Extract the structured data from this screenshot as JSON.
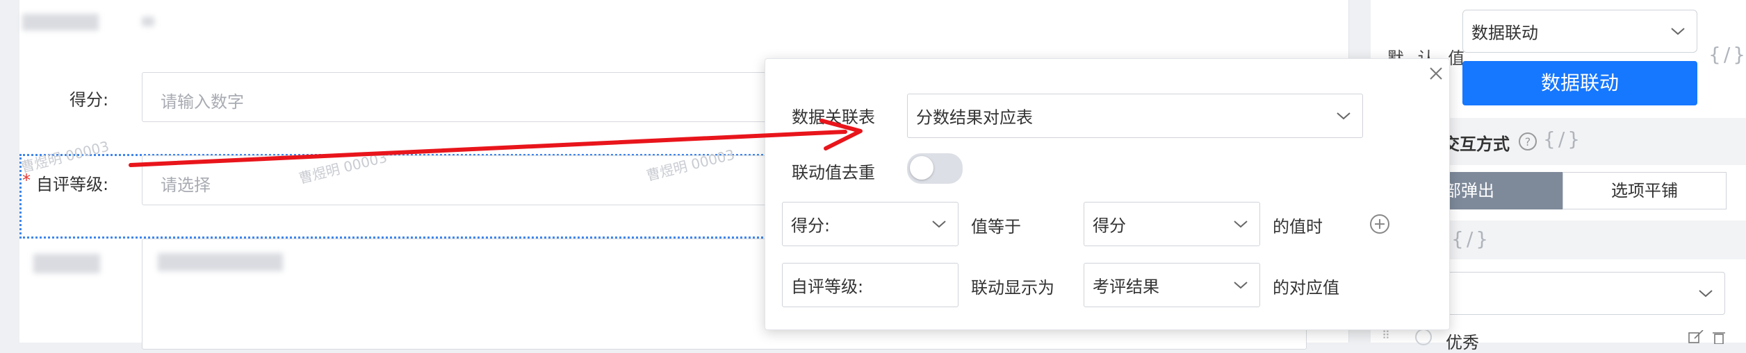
{
  "form": {
    "score_label": "得分:",
    "score_placeholder": "请输入数字",
    "grade_required_mark": "*",
    "grade_label": "自评等级:",
    "grade_placeholder": "请选择",
    "watermark": "曹煜明 00003"
  },
  "config": {
    "default_value_label": "默 认 值",
    "default_value_select": "数据联动",
    "data_link_button": "数据联动",
    "formula_mark": "{/}",
    "interaction_label": "交互方式",
    "help_icon": "question-circle-icon",
    "interaction_options": [
      "底部弹出",
      "选项平铺"
    ],
    "interaction_active": "底部弹出",
    "option_item_label": "优秀"
  },
  "popup": {
    "table_label": "数据关联表",
    "table_value": "分数结果对应表",
    "dedupe_label": "联动值去重",
    "dedupe_enabled": false,
    "condition": {
      "field": "得分:",
      "operator": "值等于",
      "target_field": "得分",
      "suffix": "的值时"
    },
    "display": {
      "field": "自评等级:",
      "operator": "联动显示为",
      "target_field": "考评结果",
      "suffix": "的对应值"
    }
  },
  "colors": {
    "primary": "#1677ff",
    "annotation_arrow": "#e8151b",
    "segment_active": "#7e8a9a",
    "required": "#e53935"
  }
}
